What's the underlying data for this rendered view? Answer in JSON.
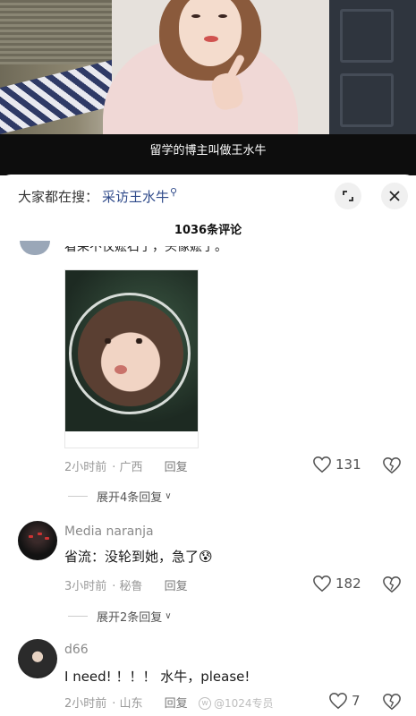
{
  "video": {
    "subtitle": "留学的博主叫做王水牛"
  },
  "sheet": {
    "search_prefix": "大家都在搜：",
    "search_query": "采访王水牛",
    "title": "1036条评论"
  },
  "comments": [
    {
      "text_cut": "看呆不仅嬷石了，头像嬷了。",
      "time": "2小时前",
      "location": "广西",
      "reply_label": "回复",
      "likes": "131",
      "expand_label": "展开4条回复"
    },
    {
      "username": "Media naranja",
      "text": "省流：没轮到她，急了",
      "emoji": "😰",
      "time": "3小时前",
      "location": "秘鲁",
      "reply_label": "回复",
      "likes": "182",
      "expand_label": "展开2条回复"
    },
    {
      "username": "d66",
      "text": "I need! ！！！ 水牛，please!",
      "time": "2小时前",
      "location": "山东",
      "reply_label": "回复",
      "likes": "7"
    }
  ],
  "watermark": "@1024专员",
  "colors": {
    "link": "#2f4a8a",
    "meta": "#9a9a9a"
  }
}
